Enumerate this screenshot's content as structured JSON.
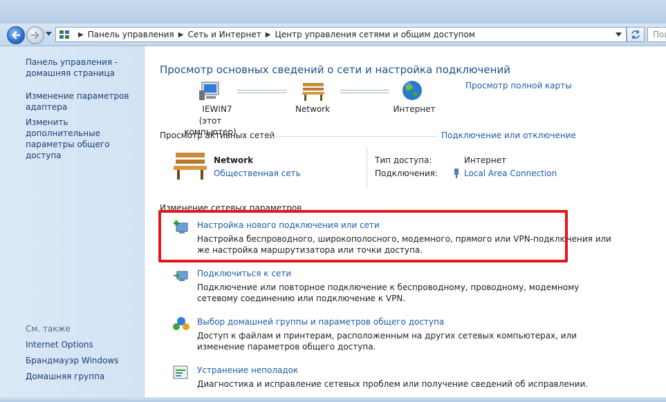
{
  "address": {
    "crumbs": [
      "Панель управления",
      "Сеть и Интернет",
      "Центр управления сетями и общим доступом"
    ],
    "search_placeholder": "Поиск в панели управления"
  },
  "sidebar": {
    "items": [
      {
        "label": "Панель управления - домашняя страница"
      },
      {
        "label": "Изменение параметров адаптера"
      },
      {
        "label": "Изменить дополнительные параметры общего доступа"
      }
    ],
    "see_also_label": "См. также",
    "see_also": [
      {
        "label": "Internet Options"
      },
      {
        "label": "Брандмауэр Windows"
      },
      {
        "label": "Домашняя группа"
      }
    ]
  },
  "main": {
    "title": "Просмотр основных сведений о сети и настройка подключений",
    "full_map_link": "Просмотр полной карты",
    "map": {
      "computer_name": "IEWIN7",
      "computer_sub": "(этот компьютер)",
      "network_name": "Network",
      "internet_name": "Интернет"
    },
    "active_networks": {
      "heading": "Просмотр активных сетей",
      "connect_link": "Подключение или отключение",
      "network_name": "Network",
      "network_type": "Общественная сеть",
      "access_label": "Тип доступа:",
      "access_value": "Интернет",
      "connections_label": "Подключения:",
      "connections_value": "Local Area Connection"
    },
    "change_settings": {
      "heading": "Изменение сетевых параметров",
      "tasks": [
        {
          "link": "Настройка нового подключения или сети",
          "desc": "Настройка беспроводного, широкополосного, модемного, прямого или VPN-подключения или же настройка маршрутизатора или точки доступа."
        },
        {
          "link": "Подключиться к сети",
          "desc": "Подключение или повторное подключение к беспроводному, проводному, модемному сетевому соединению или подключение к VPN."
        },
        {
          "link": "Выбор домашней группы и параметров общего доступа",
          "desc": "Доступ к файлам и принтерам, расположенным на других сетевых компьютерах, или изменение параметров общего доступа."
        },
        {
          "link": "Устранение неполадок",
          "desc": "Диагностика и исправление сетевых проблем или получение сведений об исправлении."
        }
      ]
    }
  },
  "colors": {
    "link": "#1d5aab",
    "title": "#1e4e8c",
    "highlight": "#e8141c",
    "sidebar_bg": "#d2e3f4"
  },
  "icons": [
    "back-arrow-icon",
    "forward-arrow-icon",
    "control-panel-icon",
    "refresh-icon",
    "computer-icon",
    "bench-icon",
    "globe-icon",
    "network-plug-icon",
    "new-connection-icon",
    "connect-network-icon",
    "homegroup-icon",
    "troubleshoot-icon"
  ]
}
